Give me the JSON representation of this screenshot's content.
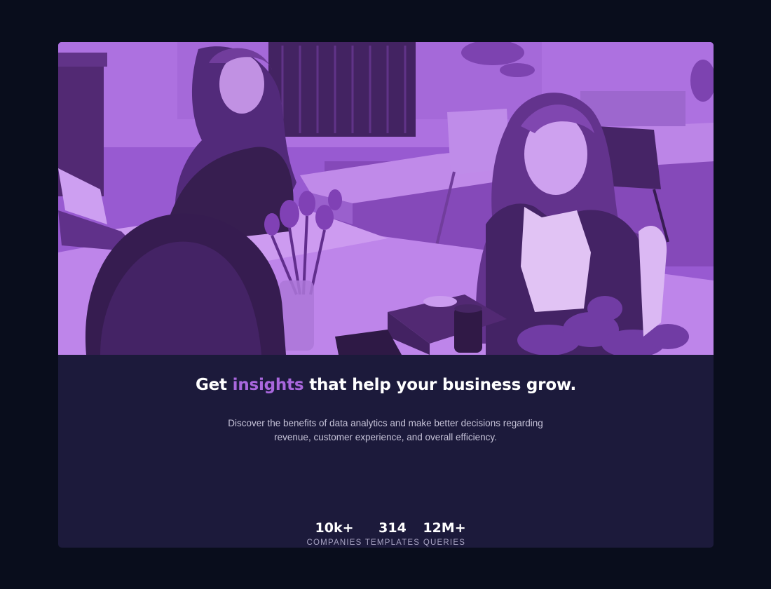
{
  "hero": {
    "image_description_icon": "team-office-photo-icon",
    "tint_color": "#8d4fc9"
  },
  "headline": {
    "before": "Get ",
    "accent": "insights",
    "after": " that help your business grow."
  },
  "description": "Discover the benefits of data analytics and make better decisions regarding revenue, customer experience, and overall efficiency.",
  "stats": [
    {
      "value": "10k+",
      "label": "COMPANIES"
    },
    {
      "value": "314",
      "label": "TEMPLATES"
    },
    {
      "value": "12M+",
      "label": "QUERIES"
    }
  ],
  "colors": {
    "page_background": "#090d1c",
    "card_background": "#1c1a3b",
    "accent": "#a967dd",
    "text": "#ffffff",
    "muted_text": "#c6c3d8"
  }
}
